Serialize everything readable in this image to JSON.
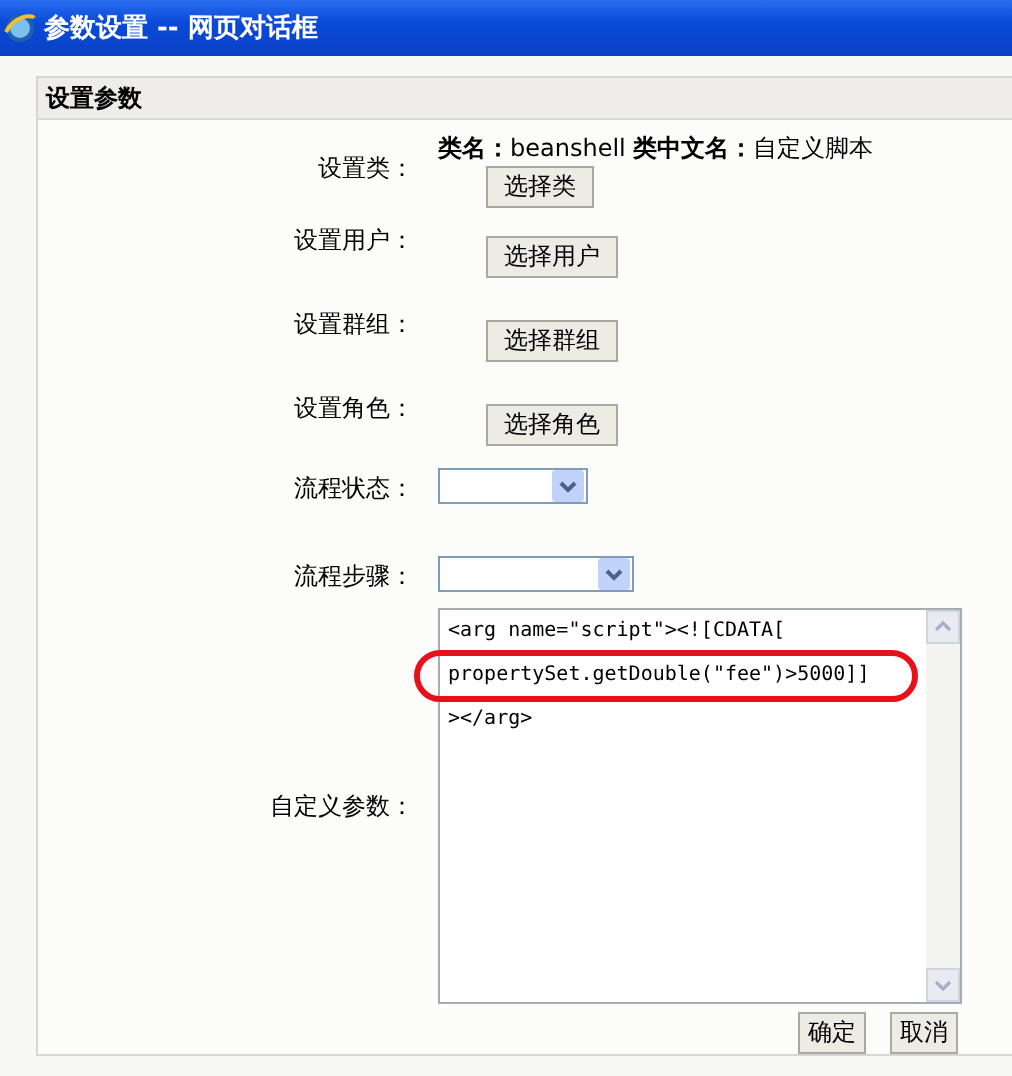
{
  "window": {
    "title": "参数设置 -- 网页对话框"
  },
  "panel": {
    "title": "设置参数"
  },
  "rows": [
    {
      "kind": "class",
      "label": "设置类：",
      "info": "**类名：**beanshell **类中文名：**自定义脚本",
      "button": "选择类"
    },
    {
      "kind": "button",
      "label": "设置用户：",
      "button": "选择用户"
    },
    {
      "kind": "button",
      "label": "设置群组：",
      "button": "选择群组"
    },
    {
      "kind": "button",
      "label": "设置角色：",
      "button": "选择角色"
    },
    {
      "kind": "select",
      "label": "流程状态："
    },
    {
      "kind": "wideselect",
      "label": "流程步骤："
    },
    {
      "kind": "textarea",
      "label": "自定义参数：",
      "lines": [
        "<arg name=\"script\"><![CDATA[",
        "propertySet.getDouble(\"fee\")>5000]]",
        "></arg>"
      ],
      "annotated": true
    }
  ],
  "buttons": [
    "确定",
    "取消"
  ]
}
